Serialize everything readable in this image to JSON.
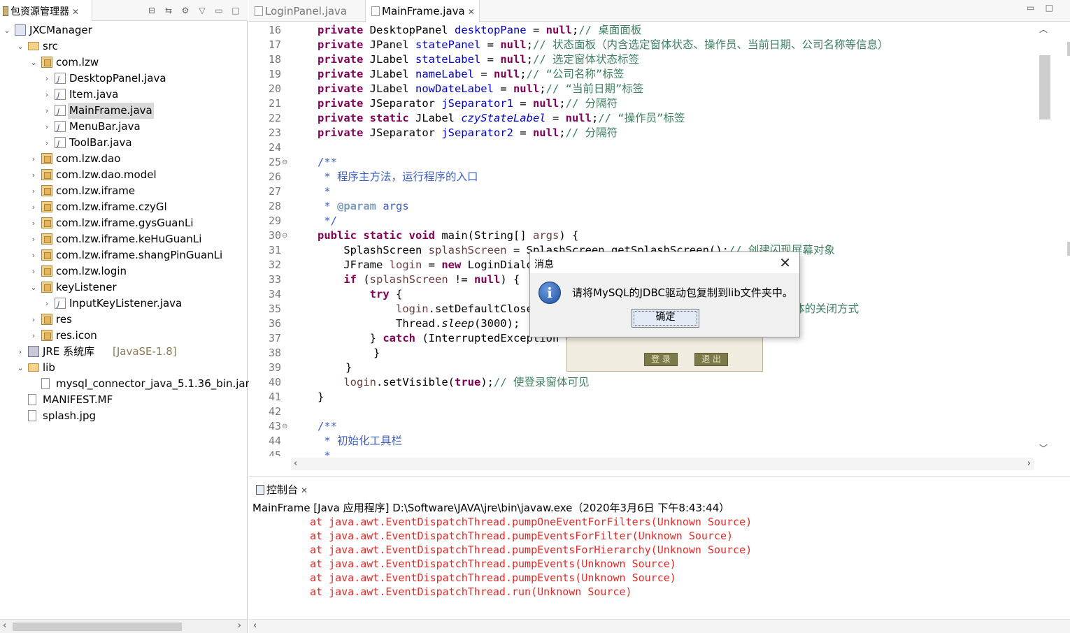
{
  "explorer": {
    "tab_label": "包资源管理器",
    "tree": [
      {
        "label": "JXCManager",
        "depth": 0,
        "icon": "project-icon",
        "expanded": true
      },
      {
        "label": "src",
        "depth": 1,
        "icon": "source-folder-icon",
        "expanded": true
      },
      {
        "label": "com.lzw",
        "depth": 2,
        "icon": "package-icon",
        "expanded": true
      },
      {
        "label": "DesktopPanel.java",
        "depth": 3,
        "icon": "java-file-icon",
        "expanded": false
      },
      {
        "label": "Item.java",
        "depth": 3,
        "icon": "java-file-icon",
        "expanded": false
      },
      {
        "label": "MainFrame.java",
        "depth": 3,
        "icon": "java-file-icon",
        "expanded": false,
        "selected": true
      },
      {
        "label": "MenuBar.java",
        "depth": 3,
        "icon": "java-file-icon",
        "expanded": false
      },
      {
        "label": "ToolBar.java",
        "depth": 3,
        "icon": "java-file-icon",
        "expanded": false
      },
      {
        "label": "com.lzw.dao",
        "depth": 2,
        "icon": "package-icon",
        "expanded": false
      },
      {
        "label": "com.lzw.dao.model",
        "depth": 2,
        "icon": "package-icon",
        "expanded": false
      },
      {
        "label": "com.lzw.iframe",
        "depth": 2,
        "icon": "package-icon",
        "expanded": false
      },
      {
        "label": "com.lzw.iframe.czyGl",
        "depth": 2,
        "icon": "package-icon",
        "expanded": false
      },
      {
        "label": "com.lzw.iframe.gysGuanLi",
        "depth": 2,
        "icon": "package-icon",
        "expanded": false
      },
      {
        "label": "com.lzw.iframe.keHuGuanLi",
        "depth": 2,
        "icon": "package-icon",
        "expanded": false
      },
      {
        "label": "com.lzw.iframe.shangPinGuanLi",
        "depth": 2,
        "icon": "package-icon",
        "expanded": false
      },
      {
        "label": "com.lzw.login",
        "depth": 2,
        "icon": "package-icon",
        "expanded": false
      },
      {
        "label": "keyListener",
        "depth": 2,
        "icon": "package-icon",
        "expanded": true
      },
      {
        "label": "InputKeyListener.java",
        "depth": 3,
        "icon": "java-file-icon",
        "expanded": false
      },
      {
        "label": "res",
        "depth": 2,
        "icon": "package-icon",
        "expanded": false
      },
      {
        "label": "res.icon",
        "depth": 2,
        "icon": "package-icon",
        "expanded": false
      },
      {
        "label": "JRE 系统库",
        "decoration": "[JavaSE-1.8]",
        "depth": 1,
        "icon": "library-icon",
        "expanded": false
      },
      {
        "label": "lib",
        "depth": 1,
        "icon": "folder-icon",
        "expanded": true
      },
      {
        "label": "mysql_connector_java_5.1.36_bin.jar",
        "depth": 2,
        "icon": "jar-file-icon",
        "leaf": true
      },
      {
        "label": "MANIFEST.MF",
        "depth": 1,
        "icon": "file-icon",
        "leaf": true
      },
      {
        "label": "splash.jpg",
        "depth": 1,
        "icon": "file-icon",
        "leaf": true
      }
    ]
  },
  "editor": {
    "tabs": [
      {
        "label": "LoginPanel.java",
        "active": false
      },
      {
        "label": "MainFrame.java",
        "active": true
      }
    ],
    "line_numbers": [
      "16",
      "17",
      "18",
      "19",
      "20",
      "21",
      "22",
      "23",
      "24",
      "25",
      "26",
      "27",
      "28",
      "29",
      "30",
      "31",
      "32",
      "33",
      "34",
      "35",
      "36",
      "37",
      "38",
      "39",
      "40",
      "41",
      "42",
      "43",
      "44",
      "45"
    ],
    "code": {
      "l16": {
        "kw": "private",
        "type": " DesktopPanel ",
        "fld": "desktopPane",
        "eq": " = ",
        "null": "null",
        "semi": ";",
        "cmt": "// 桌面面板"
      },
      "l17": {
        "kw": "private",
        "type": " JPanel ",
        "fld": "statePanel",
        "eq": " = ",
        "null": "null",
        "semi": ";",
        "cmt": "// 状态面板（内含选定窗体状态、操作员、当前日期、公司名称等信息）"
      },
      "l18": {
        "kw": "private",
        "type": " JLabel ",
        "fld": "stateLabel",
        "eq": " = ",
        "null": "null",
        "semi": ";",
        "cmt": "// 选定窗体状态标签"
      },
      "l19": {
        "kw": "private",
        "type": " JLabel ",
        "fld": "nameLabel",
        "eq": " = ",
        "null": "null",
        "semi": ";",
        "cmt": "// “公司名称”标签"
      },
      "l20": {
        "kw": "private",
        "type": " JLabel ",
        "fld": "nowDateLabel",
        "eq": " = ",
        "null": "null",
        "semi": ";",
        "cmt": "// “当前日期”标签"
      },
      "l21": {
        "kw": "private",
        "type": " JSeparator ",
        "fld": "jSeparator1",
        "eq": " = ",
        "null": "null",
        "semi": ";",
        "cmt": "// 分隔符"
      },
      "l22": {
        "kw": "private",
        "kw2": " static",
        "type": " JLabel ",
        "fld": "czyStateLabel",
        "eq": " = ",
        "null": "null",
        "semi": ";",
        "cmt": "// “操作员”标签"
      },
      "l23": {
        "kw": "private",
        "type": " JSeparator ",
        "fld": "jSeparator2",
        "eq": " = ",
        "null": "null",
        "semi": ";",
        "cmt": "// 分隔符"
      },
      "l25": "/**",
      "l26": " * 程序主方法，运行程序的入口",
      "l27": " *",
      "l28_tag": "@param",
      "l28_rest": " args",
      "l28_star": " * ",
      "l29": " */",
      "l30": {
        "kw1": "public",
        "kw2": " static",
        "kw3": " void",
        "rest1": " main(String[] ",
        "var": "args",
        "rest2": ") {"
      },
      "l31": {
        "type": "SplashScreen ",
        "var": "splashScreen",
        "rest": " = SplashScreen.getSplashScreen();",
        "cmt": "// 创建闪现屏幕对象"
      },
      "l32": {
        "type": "JFrame ",
        "var": "login",
        "rest1": " = ",
        "kw": "new",
        "rest2": " LoginDialog();"
      },
      "l33": {
        "kw": "if",
        "rest1": " (",
        "var": "splashScreen",
        "rest2": " != ",
        "null": "null",
        "rest3": ") {"
      },
      "l34": {
        "kw": "try",
        "rest": " {"
      },
      "l35": {
        "var": "login",
        "rest": ".setDefaultCloseOperation(JFrame.EXIT_ON_CLOSE);",
        "cmt": "// 设置窗体的关闭方式"
      },
      "l36": {
        "rest1": "Thread.",
        "meth": "sleep",
        "rest2": "(3000);"
      },
      "l37": {
        "rest1": "} ",
        "kw": "catch",
        "rest2": " (InterruptedException e) {"
      },
      "l38": "}",
      "l39": "}",
      "l40": {
        "var": "login",
        "rest1": ".setVisible(",
        "kw": "true",
        "rest2": ");",
        "cmt": "// 使登录窗体可见"
      },
      "l41": "}",
      "l43": "/**",
      "l44": " * 初始化工具栏",
      "l45": " *"
    }
  },
  "dialog": {
    "title": "消息",
    "message": "请将MySQL的JDBC驱动包复制到lib文件夹中。",
    "ok_label": "确定"
  },
  "login_window": {
    "login_label": "登 录",
    "exit_label": "退 出"
  },
  "console": {
    "tab_label": "控制台",
    "header": "MainFrame [Java 应用程序] D:\\Software\\JAVA\\jre\\bin\\javaw.exe（2020年3月6日 下午8:43:44）",
    "trace": [
      "at java.awt.EventDispatchThread.pumpOneEventForFilters(Unknown Source)",
      "at java.awt.EventDispatchThread.pumpEventsForFilter(Unknown Source)",
      "at java.awt.EventDispatchThread.pumpEventsForHierarchy(Unknown Source)",
      "at java.awt.EventDispatchThread.pumpEvents(Unknown Source)",
      "at java.awt.EventDispatchThread.pumpEvents(Unknown Source)",
      "at java.awt.EventDispatchThread.run(Unknown Source)"
    ]
  },
  "colors": {
    "keyword": "#7f0055",
    "field": "#0000c0",
    "comment": "#3f7f5f",
    "javadoc": "#3f5fbf",
    "error_text": "#e02a2a",
    "selection": "#d9d9d9"
  }
}
